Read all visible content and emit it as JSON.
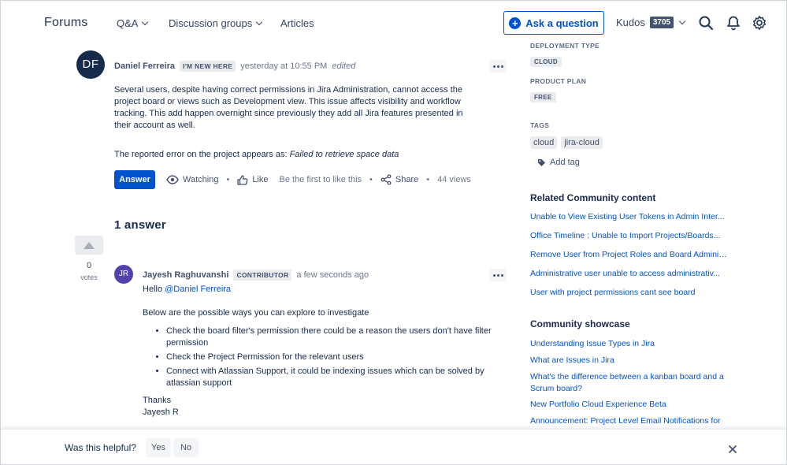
{
  "header": {
    "brand": "Forums",
    "nav": [
      "Q&A",
      "Discussion groups",
      "Articles"
    ],
    "ask_label": "Ask a question",
    "kudos_label": "Kudos",
    "kudos_count": "3705"
  },
  "question": {
    "avatar_initials": "DF",
    "author": "Daniel Ferreira",
    "badge": "I'M NEW HERE",
    "time": "yesterday at 10:55 PM",
    "edited": "edited",
    "body": "Several users, despite having correct permissions in Jira Administration, cannot access the project board or views such as Development view. This issue affects visibility and workflow tracking. This add happen overnight since previously they add all Jira features presented in their account as well.",
    "error_prefix": "The reported error on the project appears as: ",
    "error_text": "Failed to retrieve space data",
    "answer_label": "Answer",
    "watching_label": "Watching",
    "like_label": "Like",
    "like_hint": "Be the first to like this",
    "share_label": "Share",
    "views": "44 views"
  },
  "answers_heading": "1 answer",
  "answer": {
    "votes": "0",
    "votes_label": "votes",
    "avatar_initials": "JR",
    "author": "Jayesh Raghuvanshi",
    "badge": "CONTRIBUTOR",
    "time": "a few seconds ago",
    "greeting": "Hello ",
    "mention": "@Daniel Ferreira",
    "intro": "Below are the possible ways you can explore to investigate",
    "items": [
      "Check the board filter's permission there could be a reason the users don't have filter permission",
      "Check the Project Permission for the relevant users",
      "Connect with Atlassian Support, it could be indexing issues which can be solved by atlassian support"
    ],
    "thanks": "Thanks",
    "signature": "Jayesh R"
  },
  "sidebar": {
    "deployment_label": "DEPLOYMENT TYPE",
    "deployment_value": "CLOUD",
    "plan_label": "PRODUCT PLAN",
    "plan_value": "FREE",
    "tags_label": "TAGS",
    "tags": [
      "cloud",
      "jira-cloud"
    ],
    "add_tag": "Add tag",
    "related_heading": "Related Community content",
    "related": [
      "Unable to View Existing User Tokens in Admin Inter...",
      "Office Timeline : Unable to Import Projects/Boards...",
      "Remove User from Project Roles and Board Administr...",
      "Administrative user unable to access administrativ...",
      "User with project permissions cant see board"
    ],
    "showcase_heading": "Community showcase",
    "showcase": [
      "Understanding Issue Types in Jira",
      "What are Issues in Jira",
      "What's the difference between a kanban board and a Scrum board?",
      "New Portfolio Cloud Experience Beta",
      "Announcement: Project Level Email Notifications for"
    ]
  },
  "helpful": {
    "question": "Was this helpful?",
    "yes": "Yes",
    "no": "No"
  },
  "colors": {
    "primary": "#0052cc",
    "navy": "#172b4d",
    "avatar_jr": "#5243aa"
  }
}
